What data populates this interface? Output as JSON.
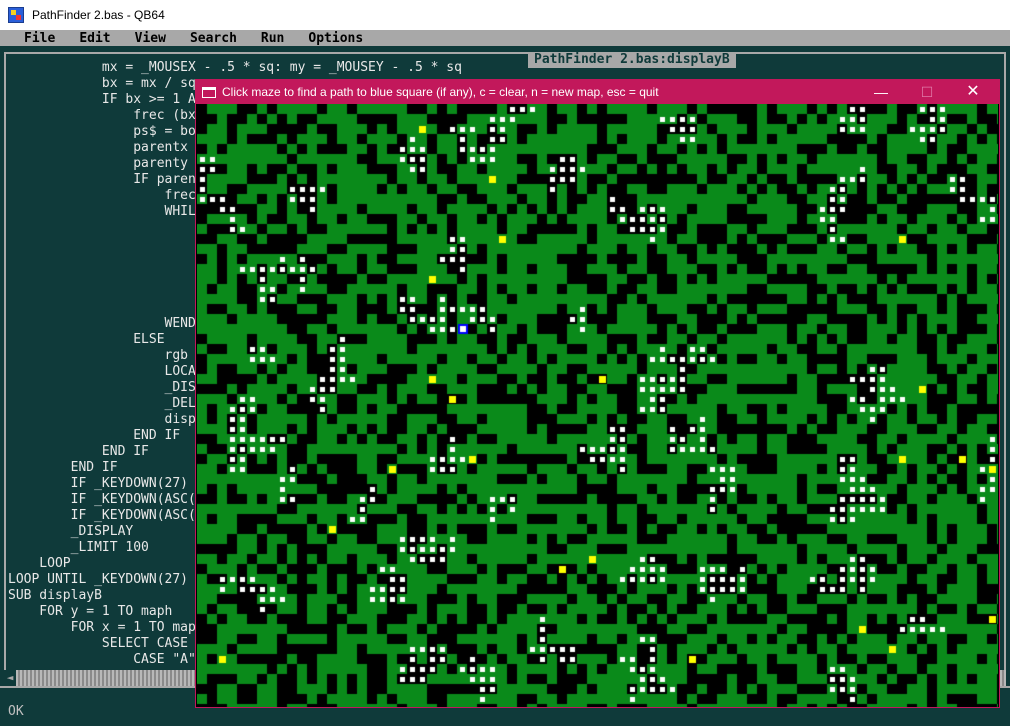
{
  "window": {
    "title": "PathFinder 2.bas - QB64"
  },
  "menubar": {
    "items": [
      "File",
      "Edit",
      "View",
      "Search",
      "Run",
      "Options"
    ]
  },
  "editor": {
    "doc_title": "PathFinder 2.bas:displayB",
    "lines": [
      "            mx = _MOUSEX - .5 * sq: my = _MOUSEY - .5 * sq",
      "            bx = mx / sq",
      "            IF bx >= 1 A",
      "                frec (bx",
      "                ps$ = bo",
      "                parentx",
      "                parenty",
      "                IF paren",
      "                    frec",
      "                    WHIL",
      "",
      "",
      "",
      "",
      "",
      "",
      "                    WEND",
      "                ELSE",
      "                    rgb",
      "                    LOCA",
      "                    _DIS",
      "                    _DEL",
      "                    disp",
      "                END IF",
      "            END IF",
      "        END IF",
      "        IF _KEYDOWN(27)",
      "        IF _KEYDOWN(ASC(",
      "        IF _KEYDOWN(ASC(",
      "        _DISPLAY",
      "        _LIMIT 100",
      "    LOOP",
      "LOOP UNTIL _KEYDOWN(27)",
      "SUB displayB",
      "    FOR y = 1 TO maph",
      "        FOR x = 1 TO map",
      "            SELECT CASE",
      "                CASE \"A\""
    ]
  },
  "status": {
    "text": "OK"
  },
  "pathfinder": {
    "title": "Click maze to find a path to blue square (if any), c = clear, n = new map, esc = quit",
    "controls": {
      "minimize": "—",
      "maximize": "☐",
      "close": "✕"
    },
    "colors": {
      "wall": "#000000",
      "open": "#0a8a1a",
      "path": "#ffffff",
      "start": "#ffff00",
      "goal": "#0000ff"
    }
  }
}
